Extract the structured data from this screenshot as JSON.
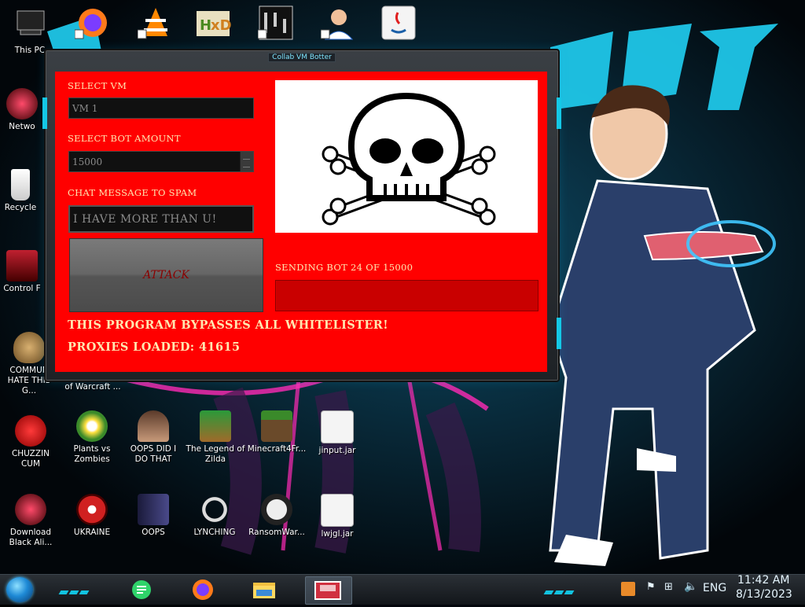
{
  "desktop": {
    "left_icons": [
      {
        "label": "This PC"
      },
      {
        "label": "Netwo"
      },
      {
        "label": "Recycle"
      },
      {
        "label": "Control F"
      },
      {
        "label": "COMMUN HATE THIS G..."
      },
      {
        "label": "of Warcraft ..."
      }
    ],
    "bottom_icons": [
      {
        "label": "CHUZZIN CUM"
      },
      {
        "label": "Plants vs Zombies"
      },
      {
        "label": "OOPS DID I DO THAT"
      },
      {
        "label": "The Legend of Zilda"
      },
      {
        "label": "Minecraft4Fr..."
      },
      {
        "label": "jinput.jar"
      },
      {
        "label": "Download Black Ali..."
      },
      {
        "label": "UKRAINE"
      },
      {
        "label": "OOPS"
      },
      {
        "label": "LYNCHING"
      },
      {
        "label": "RansomWar..."
      },
      {
        "label": "lwjgl.jar"
      }
    ]
  },
  "window": {
    "title": "Collab VM Botter",
    "select_vm_label": "SELECT VM",
    "select_vm_value": "VM 1",
    "bot_amount_label": "SELECT BOT AMOUNT",
    "bot_amount_value": "15000",
    "chat_label": "CHAT MESSAGE TO SPAM",
    "chat_value": "I HAVE MORE THAN U!",
    "attack_label": "ATTACK",
    "status_text": "SENDING BOT 24 OF 15000",
    "progress_fraction": 0.0016,
    "bypass_text": "THIS PROGRAM BYPASSES ALL WHITELISTER!",
    "proxies_text": "PROXIES LOADED: 41615",
    "panel_color": "#ff0000",
    "image_icon": "skull-crossbones-icon"
  },
  "taskbar": {
    "items": [
      "notes-app-icon",
      "firefox-icon",
      "file-explorer-icon",
      "vm-window-icon"
    ],
    "tray_language": "ENG",
    "time": "11:42 AM",
    "date": "8/13/2023"
  },
  "colors": {
    "accent": "#14c8e6",
    "panel": "#ff0000",
    "label_text": "#ffe6b0"
  }
}
